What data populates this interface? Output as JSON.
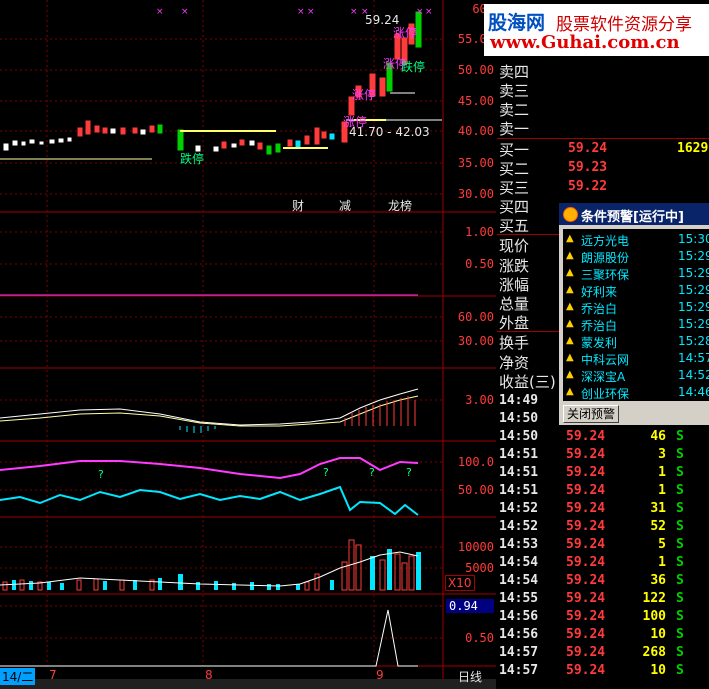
{
  "price_axis": [
    "60.",
    "55.00",
    "50.00",
    "45.00",
    "40.00",
    "35.00",
    "30.00"
  ],
  "ind1_axis": [
    "1.00",
    "0.50"
  ],
  "ind2_axis": [
    "60.00",
    "30.00"
  ],
  "ind3_axis": [
    "3.00"
  ],
  "ind4_axis": [
    "100.0",
    "50.00"
  ],
  "vol_axis": [
    "10000",
    "5000"
  ],
  "vol_unit": "X10",
  "last_axis": [
    "0.94",
    "0.50"
  ],
  "chart_labels": {
    "high_price": "59.24",
    "range": "41.70 - 42.03",
    "limit_up": "涨停",
    "limit_down": "跌停",
    "news_cai": "财",
    "news_jian": "减",
    "news_long": "龙榜",
    "q": "?"
  },
  "date_axis": {
    "d0": "14/二",
    "d1": "7",
    "d2": "8",
    "d3": "9",
    "period": "日线"
  },
  "watermark": {
    "logo": "股海网",
    "slogan": "股票软件资源分享",
    "url": "www.Guhai.com.cn"
  },
  "orderbook": {
    "asks": [
      "卖四",
      "卖三",
      "卖二",
      "卖一"
    ],
    "bids": [
      {
        "label": "买一",
        "price": "59.24",
        "vol": "1629"
      },
      {
        "label": "买二",
        "price": "59.23",
        "vol": ""
      },
      {
        "label": "买三",
        "price": "59.22",
        "vol": ""
      },
      {
        "label": "买四",
        "price": "",
        "vol": ""
      },
      {
        "label": "买五",
        "price": "",
        "vol": ""
      }
    ]
  },
  "stats": [
    "现价",
    "涨跌",
    "涨幅",
    "总量",
    "外盘",
    "换手",
    "净资",
    "收益(三)"
  ],
  "alert_panel": {
    "title": "条件预警[运行中]",
    "items": [
      {
        "name": "远方光电",
        "time": "15:30"
      },
      {
        "name": "朗源股份",
        "time": "15:29"
      },
      {
        "name": "三聚环保",
        "time": "15:29"
      },
      {
        "name": "好利来",
        "time": "15:29"
      },
      {
        "name": "乔治白",
        "time": "15:29"
      },
      {
        "name": "乔治白",
        "time": "15:29"
      },
      {
        "name": "蒙发利",
        "time": "15:28"
      },
      {
        "name": "中科云网",
        "time": "14:57"
      },
      {
        "name": "深深宝A",
        "time": "14:52"
      },
      {
        "name": "创业环保",
        "time": "14:46"
      }
    ],
    "close_label": "关闭预警"
  },
  "ticks": [
    {
      "time": "14:49",
      "price": "",
      "vol": "",
      "side": ""
    },
    {
      "time": "14:50",
      "price": "",
      "vol": "",
      "side": ""
    },
    {
      "time": "14:50",
      "price": "59.24",
      "vol": "46",
      "side": "S"
    },
    {
      "time": "14:51",
      "price": "59.24",
      "vol": "3",
      "side": "S"
    },
    {
      "time": "14:51",
      "price": "59.24",
      "vol": "1",
      "side": "S"
    },
    {
      "time": "14:51",
      "price": "59.24",
      "vol": "1",
      "side": "S"
    },
    {
      "time": "14:52",
      "price": "59.24",
      "vol": "31",
      "side": "S"
    },
    {
      "time": "14:52",
      "price": "59.24",
      "vol": "52",
      "side": "S"
    },
    {
      "time": "14:53",
      "price": "59.24",
      "vol": "5",
      "side": "S"
    },
    {
      "time": "14:54",
      "price": "59.24",
      "vol": "1",
      "side": "S"
    },
    {
      "time": "14:54",
      "price": "59.24",
      "vol": "36",
      "side": "S"
    },
    {
      "time": "14:55",
      "price": "59.24",
      "vol": "122",
      "side": "S"
    },
    {
      "time": "14:56",
      "price": "59.24",
      "vol": "100",
      "side": "S"
    },
    {
      "time": "14:56",
      "price": "59.24",
      "vol": "10",
      "side": "S"
    },
    {
      "time": "14:57",
      "price": "59.24",
      "vol": "268",
      "side": "S"
    },
    {
      "time": "14:57",
      "price": "59.24",
      "vol": "10",
      "side": "S"
    }
  ],
  "colors": {
    "up": "#ff3b3b",
    "down": "#00e8ff",
    "grid": "#a00000",
    "vol": "#ffff00",
    "sell": "#00d000"
  }
}
